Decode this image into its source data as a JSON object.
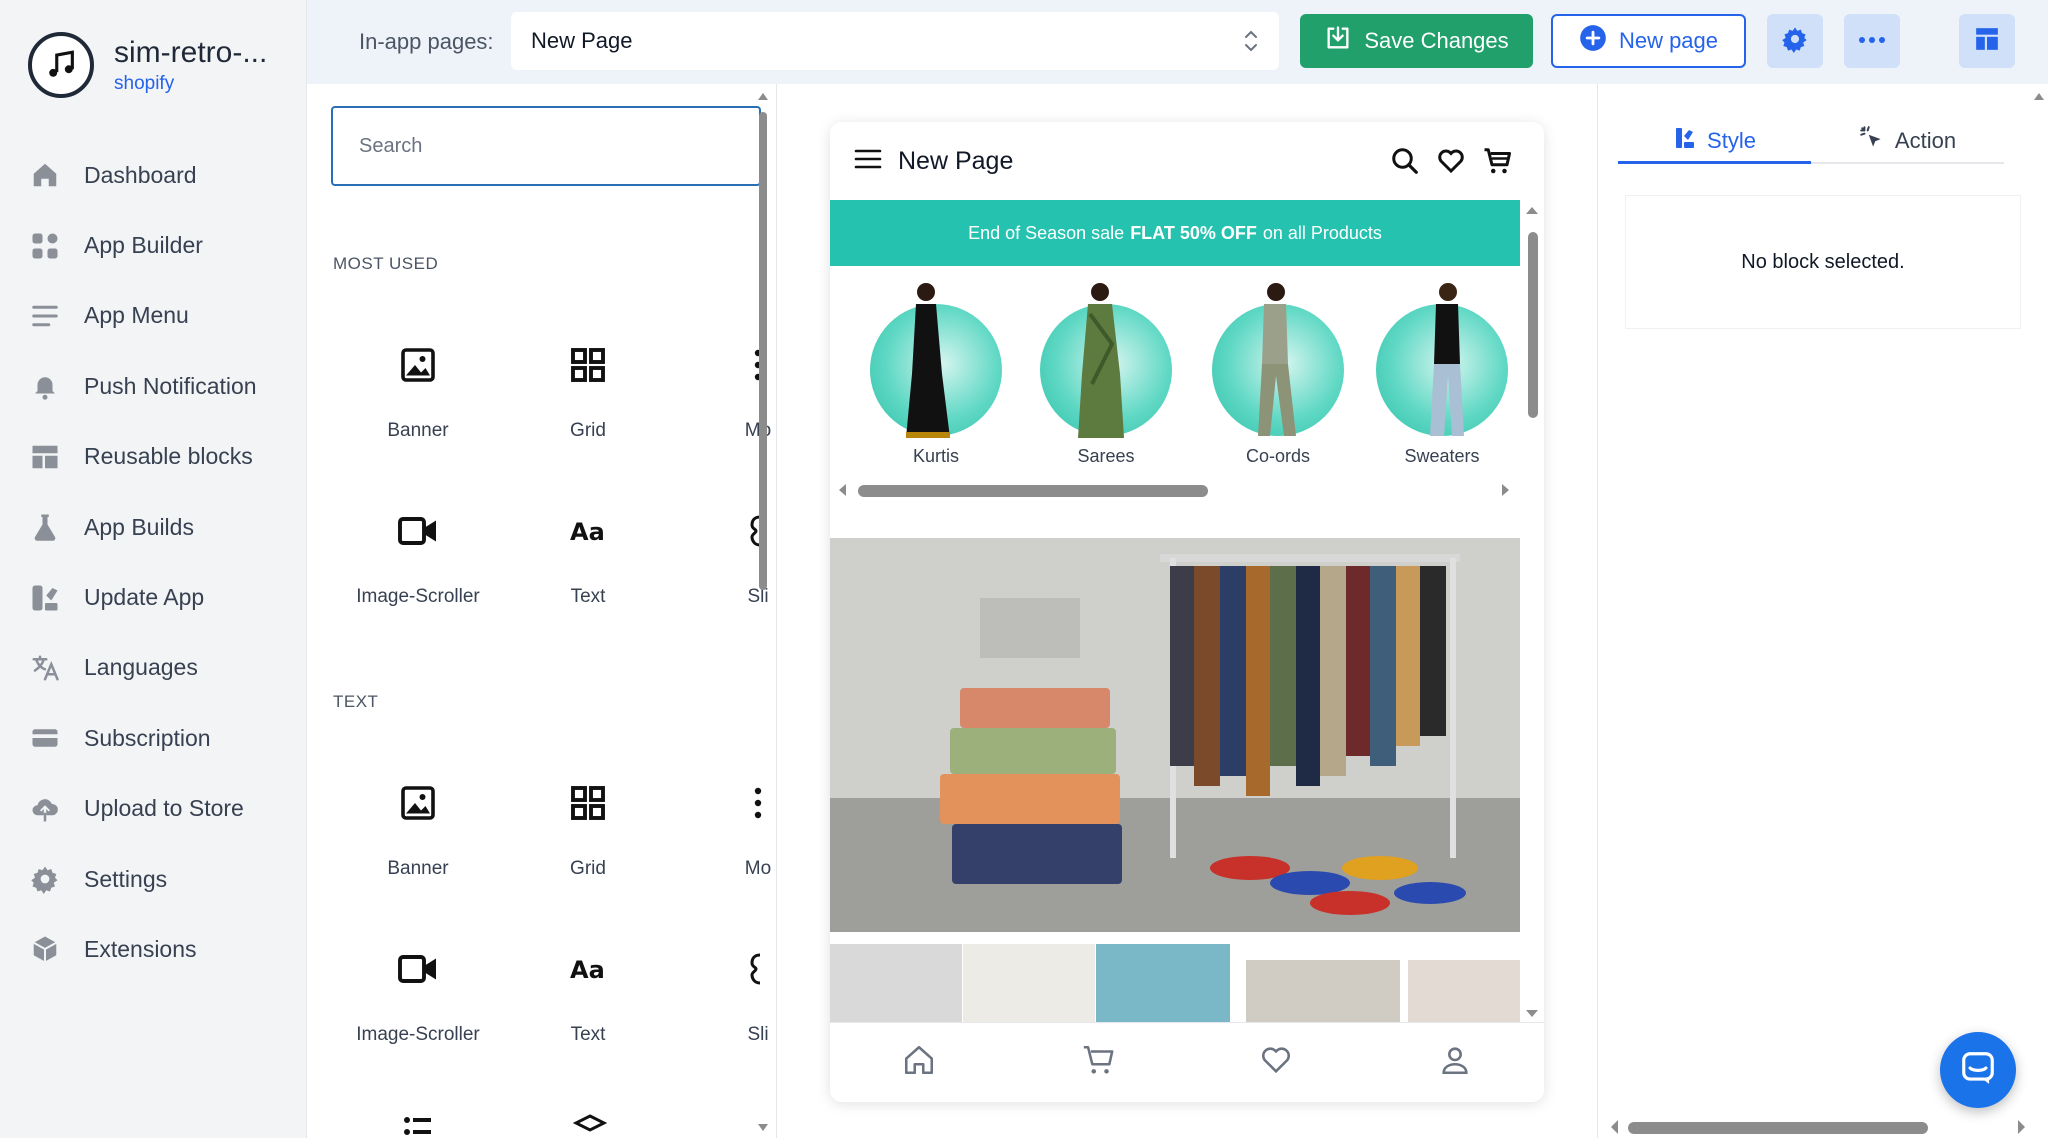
{
  "app": {
    "name": "sim-retro-...",
    "platform": "shopify"
  },
  "sidebar": {
    "items": [
      {
        "label": "Dashboard",
        "icon": "home-icon"
      },
      {
        "label": "App Builder",
        "icon": "grid-icon"
      },
      {
        "label": "App Menu",
        "icon": "menu-icon"
      },
      {
        "label": "Push Notification",
        "icon": "bell-icon"
      },
      {
        "label": "Reusable blocks",
        "icon": "layout-icon"
      },
      {
        "label": "App Builds",
        "icon": "flask-icon"
      },
      {
        "label": "Update App",
        "icon": "update-icon"
      },
      {
        "label": "Languages",
        "icon": "translate-icon"
      },
      {
        "label": "Subscription",
        "icon": "card-icon"
      },
      {
        "label": "Upload to Store",
        "icon": "upload-cloud-icon"
      },
      {
        "label": "Settings",
        "icon": "gear-icon"
      },
      {
        "label": "Extensions",
        "icon": "cube-icon"
      }
    ]
  },
  "topbar": {
    "label": "In-app pages:",
    "selected_page": "New Page",
    "save_label": "Save Changes",
    "new_page_label": "New page"
  },
  "blocks": {
    "search_placeholder": "Search",
    "sections": [
      {
        "title": "MOST USED",
        "tiles": [
          {
            "label": "Banner",
            "icon": "image-icon"
          },
          {
            "label": "Grid",
            "icon": "grid-icon"
          },
          {
            "label": "Mo",
            "icon": "more-vertical-icon"
          },
          {
            "label": "Image-Scroller",
            "icon": "video-icon"
          },
          {
            "label": "Text",
            "icon": "text-icon"
          },
          {
            "label": "Sli",
            "icon": "slider-icon"
          }
        ]
      },
      {
        "title": "TEXT",
        "tiles": [
          {
            "label": "Banner",
            "icon": "image-icon"
          },
          {
            "label": "Grid",
            "icon": "grid-icon"
          },
          {
            "label": "Mo",
            "icon": "more-vertical-icon"
          },
          {
            "label": "Image-Scroller",
            "icon": "video-icon"
          },
          {
            "label": "Text",
            "icon": "text-icon"
          },
          {
            "label": "Sli",
            "icon": "slider-icon"
          }
        ]
      }
    ]
  },
  "phone": {
    "title": "New Page",
    "promo": {
      "pre": "End of Season sale",
      "bold": "FLAT 50% OFF",
      "post": "on all Products"
    },
    "categories": [
      "Kurtis",
      "Sarees",
      "Co-ords",
      "Sweaters"
    ]
  },
  "props": {
    "tabs": [
      {
        "label": "Style"
      },
      {
        "label": "Action"
      }
    ],
    "empty_message": "No block selected."
  },
  "colors": {
    "accent": "#2563eb",
    "save": "#22a06b",
    "promo": "#25c2b0"
  }
}
